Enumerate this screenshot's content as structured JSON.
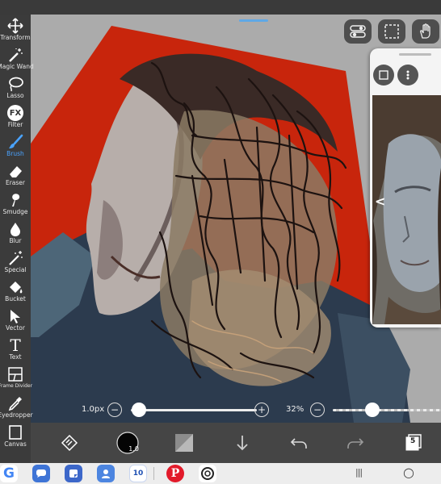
{
  "toolbar": {
    "tools": [
      {
        "key": "transform",
        "label": "Transform",
        "icon": "transform-icon"
      },
      {
        "key": "magic-wand",
        "label": "Magic Wand",
        "icon": "magic-wand-icon"
      },
      {
        "key": "lasso",
        "label": "Lasso",
        "icon": "lasso-icon"
      },
      {
        "key": "filter",
        "label": "Filter",
        "icon": "fx-icon",
        "glyph": "FX"
      },
      {
        "key": "brush",
        "label": "Brush",
        "icon": "brush-icon",
        "active": true
      },
      {
        "key": "eraser",
        "label": "Eraser",
        "icon": "eraser-icon"
      },
      {
        "key": "smudge",
        "label": "Smudge",
        "icon": "smudge-icon"
      },
      {
        "key": "blur",
        "label": "Blur",
        "icon": "blur-drop-icon"
      },
      {
        "key": "special",
        "label": "Special",
        "icon": "special-wand-icon"
      },
      {
        "key": "bucket",
        "label": "Bucket",
        "icon": "bucket-icon"
      },
      {
        "key": "vector",
        "label": "Vector",
        "icon": "vector-cursor-icon"
      },
      {
        "key": "text",
        "label": "Text",
        "icon": "text-icon",
        "glyph": "T"
      },
      {
        "key": "frame-divider",
        "label": "Frame Divider",
        "icon": "frame-divider-icon"
      },
      {
        "key": "eyedropper",
        "label": "Eyedropper",
        "icon": "eyedropper-icon"
      },
      {
        "key": "canvas",
        "label": "Canvas",
        "icon": "canvas-icon"
      }
    ]
  },
  "top_controls": {
    "toggle_icon": "toggle-switch-icon",
    "selection_icon": "dashed-selection-icon",
    "hand_icon": "hand-icon"
  },
  "reference_panel": {
    "frame_icon": "frame-square-icon",
    "menu_icon": "more-vertical-icon",
    "nav_icon": "chevron-left-icon",
    "nav_glyph": "<"
  },
  "sliders": {
    "brush_size": {
      "label": "1.0px",
      "minus": "−",
      "plus": "+",
      "fraction": 0.03
    },
    "opacity": {
      "label": "32%",
      "minus": "−",
      "fraction": 0.32
    }
  },
  "bottom_bar": {
    "brush_size_badge": "1.0",
    "layer_count": "5",
    "icons": [
      "quick-menu-icon",
      "brush-preview-icon",
      "color-swatch-icon",
      "download-arrow-icon",
      "undo-icon",
      "redo-icon",
      "layers-icon"
    ]
  },
  "nav_bar": {
    "apps": [
      {
        "name": "google-icon",
        "glyph": "G",
        "color": "#4285F4",
        "bg": "#ffffff"
      },
      {
        "name": "messages-icon",
        "glyph": "",
        "color": "#ffffff",
        "bg": "#3e74d6"
      },
      {
        "name": "notes-icon",
        "glyph": "",
        "color": "#ffffff",
        "bg": "#3c67c9"
      },
      {
        "name": "contacts-icon",
        "glyph": "",
        "color": "#ffffff",
        "bg": "#4c85e0"
      },
      {
        "name": "calendar-icon",
        "glyph": "10",
        "color": "#1d4fb3",
        "bg": "#ffffff"
      },
      {
        "name": "pinterest-icon",
        "glyph": "P",
        "color": "#ffffff",
        "bg": "#e21a2a"
      },
      {
        "name": "vsco-icon",
        "glyph": "",
        "color": "#222222",
        "bg": "#ffffff"
      }
    ],
    "recents_glyph": "|||",
    "home_glyph": "○"
  },
  "colors": {
    "accent": "#4aa3ff",
    "artwork_red": "#c8250c",
    "canvas_gray": "#ababab",
    "toolbar": "#3b3b3b"
  }
}
